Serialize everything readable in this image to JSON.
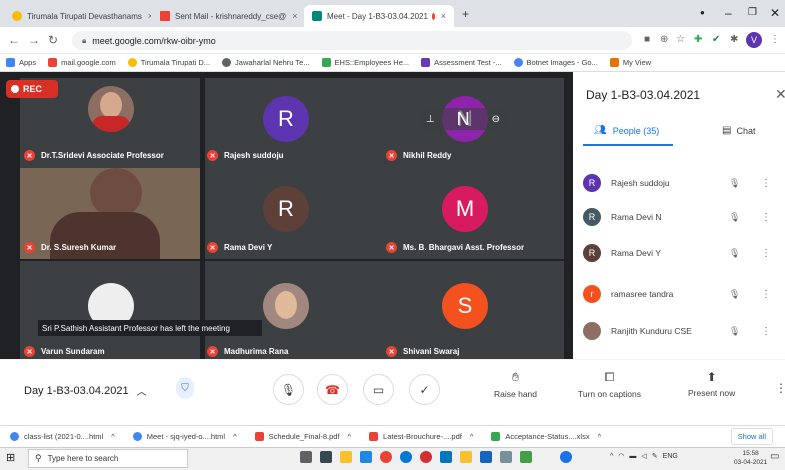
{
  "browser": {
    "tabs": [
      {
        "label": "Tirumala Tirupati Devasthanams",
        "close": "×"
      },
      {
        "label": "Sent Mail - krishnareddy_cse@",
        "close": "×"
      },
      {
        "label": "Meet - Day 1-B3-03.04.2021",
        "close": "×"
      }
    ],
    "new_tab": "+",
    "url": "meet.google.com/rkw-oibr-ymo",
    "bookmarks": [
      {
        "label": "Apps",
        "color": "#4285f4"
      },
      {
        "label": "mail.google.com",
        "color": "#ea4335"
      },
      {
        "label": "Tirumala Tirupati D...",
        "color": "#fbbc04"
      },
      {
        "label": "Jawaharlal Nehru Te...",
        "color": "#5f6368"
      },
      {
        "label": "EHS::Employees He...",
        "color": "#34a853"
      },
      {
        "label": "Assessment Test -...",
        "color": "#673ab7"
      },
      {
        "label": "Botnet Images - Go...",
        "color": "#4285f4"
      },
      {
        "label": "My View",
        "color": "#e37400"
      }
    ],
    "account_initial": "V"
  },
  "meet": {
    "rec_label": "REC",
    "participants": [
      {
        "name": "Dr.T.Sridevi Associate Professor",
        "kind": "photo",
        "color": "#8d6e63"
      },
      {
        "name": "Rajesh suddoju",
        "initial": "R",
        "color": "#5e35b1"
      },
      {
        "name": "Nikhil Reddy",
        "initial": "N",
        "color": "#8e24aa"
      },
      {
        "name": "Dr. S.Suresh Kumar",
        "kind": "video",
        "color": "#6d4c41"
      },
      {
        "name": "Rama Devi Y",
        "initial": "R",
        "color": "#5d4037"
      },
      {
        "name": "Ms. B. Bhargavi Asst. Professor",
        "initial": "M",
        "color": "#d81b60"
      },
      {
        "name": "Varun Sundaram",
        "kind": "photo",
        "color": "#eeeeee"
      },
      {
        "name": "Madhurima Rana",
        "kind": "photo",
        "color": "#a1887f"
      },
      {
        "name": "Shivani Swaraj",
        "initial": "S",
        "color": "#f4511e"
      }
    ],
    "toast": "Sri P.Sathish Assistant Professor has left the meeting",
    "meeting_title": "Day 1-B3-03.04.2021",
    "controls": {
      "raise_hand": "Raise hand",
      "captions": "Turn on captions",
      "present": "Present now"
    }
  },
  "panel": {
    "title": "Day 1-B3-03.04.2021",
    "people_tab": "People (35)",
    "chat_tab": "Chat",
    "list": [
      {
        "name": "Rajesh suddoju",
        "initial": "R",
        "color": "#5e35b1"
      },
      {
        "name": "Rama Devi N",
        "initial": "R",
        "color": "#455a64"
      },
      {
        "name": "Rama Devi Y",
        "initial": "R",
        "color": "#5d4037"
      },
      {
        "name": "ramasree tandra",
        "initial": "r",
        "color": "#f4511e"
      },
      {
        "name": "Ranjith Kunduru CSE",
        "initial": "",
        "color": "#8d6e63"
      }
    ]
  },
  "downloads": {
    "items": [
      {
        "label": "class-list (2021-0....html",
        "color": "#4285f4"
      },
      {
        "label": "Meet - sjq-iyed-o....html",
        "color": "#4285f4"
      },
      {
        "label": "Schedule_Final-8.pdf",
        "color": "#ea4335"
      },
      {
        "label": "Latest-Brouchure-....pdf",
        "color": "#ea4335"
      },
      {
        "label": "Acceptance-Status....xlsx",
        "color": "#34a853"
      }
    ],
    "show_all": "Show all"
  },
  "taskbar": {
    "search_placeholder": "Type here to search",
    "lang": "ENG",
    "time": "15:58",
    "date": "03-04-2021"
  }
}
